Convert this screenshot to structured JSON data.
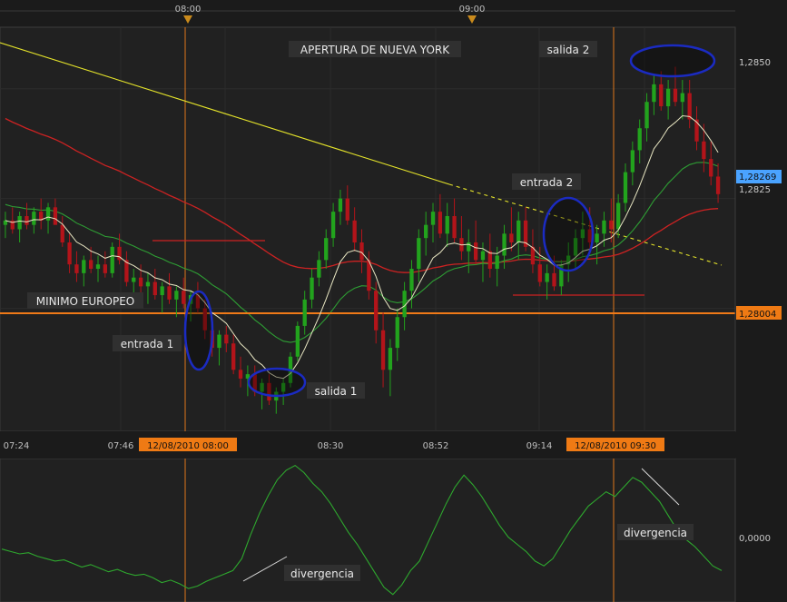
{
  "colors": {
    "background": "#1b1b1b",
    "plot_bg": "#212121",
    "grid": "#2c2c2c",
    "up": "#22a31d",
    "down": "#b3141a",
    "ema_fast": "#e8e6c2",
    "ema_mid": "#2e9e34",
    "ema_slow": "#cc2222",
    "trendline": "#e4e32a",
    "support": "#f07a18",
    "oscillator": "#2ea82e",
    "highlight_ellipse": "#1b2bc2",
    "price_tag_blue": "#4aa3ff",
    "price_tag_orange": "#ef7a14"
  },
  "top_time_markers": [
    "08:00",
    "09:00"
  ],
  "time_axis": {
    "ticks": [
      "07:24",
      "07:46",
      "08:30",
      "08:52",
      "09:14"
    ],
    "highlight_labels": [
      "12/08/2010 08:00",
      "12/08/2010 09:30"
    ]
  },
  "price_axis": {
    "ticks": [
      "1,2850",
      "1,2825"
    ],
    "current_price": "1,28269",
    "support_price": "1,28004"
  },
  "oscillator_axis": {
    "zero_label": "0,0000"
  },
  "annotations": {
    "session_open": "APERTURA DE NUEVA YORK",
    "european_low": "MINIMO EUROPEO",
    "entry1": "entrada 1",
    "exit1": "salida 1",
    "entry2": "entrada 2",
    "exit2": "salida 2",
    "divergence1": "divergencia",
    "divergence2": "divergencia"
  },
  "chart_data": {
    "type": "candlestick",
    "y_range": [
      1.2772,
      1.2864
    ],
    "oscillator_range": [
      -0.0042,
      0.0072
    ],
    "candles": [
      [
        1.2819,
        1.2822,
        1.2816,
        1.282
      ],
      [
        1.282,
        1.2823,
        1.2817,
        1.2818
      ],
      [
        1.2818,
        1.2822,
        1.2815,
        1.2821
      ],
      [
        1.2821,
        1.2824,
        1.2818,
        1.2819
      ],
      [
        1.2819,
        1.2823,
        1.2817,
        1.2822
      ],
      [
        1.2822,
        1.2825,
        1.2818,
        1.282
      ],
      [
        1.282,
        1.2824,
        1.2817,
        1.2823
      ],
      [
        1.2823,
        1.2825,
        1.2819,
        1.2819
      ],
      [
        1.2819,
        1.2821,
        1.2814,
        1.2815
      ],
      [
        1.2815,
        1.2817,
        1.2808,
        1.281
      ],
      [
        1.281,
        1.2813,
        1.2806,
        1.2808
      ],
      [
        1.2808,
        1.2812,
        1.2805,
        1.2811
      ],
      [
        1.2811,
        1.2814,
        1.2808,
        1.2809
      ],
      [
        1.2809,
        1.2812,
        1.2806,
        1.281
      ],
      [
        1.281,
        1.2813,
        1.2807,
        1.2808
      ],
      [
        1.2808,
        1.2815,
        1.2807,
        1.2814
      ],
      [
        1.2814,
        1.2817,
        1.281,
        1.2811
      ],
      [
        1.2811,
        1.2813,
        1.2805,
        1.2806
      ],
      [
        1.2806,
        1.2809,
        1.2802,
        1.2807
      ],
      [
        1.2807,
        1.281,
        1.2803,
        1.2805
      ],
      [
        1.2805,
        1.2808,
        1.2801,
        1.2806
      ],
      [
        1.2806,
        1.2809,
        1.2802,
        1.2803
      ],
      [
        1.2803,
        1.2806,
        1.2799,
        1.2805
      ],
      [
        1.2805,
        1.2808,
        1.2801,
        1.2802
      ],
      [
        1.2802,
        1.2805,
        1.2798,
        1.2804
      ],
      [
        1.2804,
        1.2807,
        1.28,
        1.2801
      ],
      [
        1.2801,
        1.2804,
        1.2797,
        1.2803
      ],
      [
        1.2803,
        1.2806,
        1.2799,
        1.28
      ],
      [
        1.28,
        1.2802,
        1.2793,
        1.2795
      ],
      [
        1.2795,
        1.2798,
        1.2789,
        1.2791
      ],
      [
        1.2791,
        1.2795,
        1.2787,
        1.2794
      ],
      [
        1.2794,
        1.2796,
        1.279,
        1.2792
      ],
      [
        1.2792,
        1.2794,
        1.2785,
        1.2786
      ],
      [
        1.2786,
        1.2789,
        1.2782,
        1.2784
      ],
      [
        1.2784,
        1.2787,
        1.278,
        1.2785
      ],
      [
        1.2785,
        1.2787,
        1.278,
        1.2781
      ],
      [
        1.2781,
        1.2784,
        1.2777,
        1.2783
      ],
      [
        1.2783,
        1.2785,
        1.2778,
        1.2779
      ],
      [
        1.2779,
        1.2782,
        1.2776,
        1.2781
      ],
      [
        1.2781,
        1.2784,
        1.2778,
        1.2783
      ],
      [
        1.2783,
        1.279,
        1.2782,
        1.2789
      ],
      [
        1.2789,
        1.2797,
        1.2788,
        1.2796
      ],
      [
        1.2796,
        1.2804,
        1.2794,
        1.2802
      ],
      [
        1.2802,
        1.2809,
        1.28,
        1.2807
      ],
      [
        1.2807,
        1.2813,
        1.2805,
        1.2811
      ],
      [
        1.2811,
        1.2818,
        1.2809,
        1.2816
      ],
      [
        1.2816,
        1.2824,
        1.2814,
        1.2822
      ],
      [
        1.2822,
        1.2827,
        1.2819,
        1.2825
      ],
      [
        1.2825,
        1.2828,
        1.2819,
        1.282
      ],
      [
        1.282,
        1.2823,
        1.2813,
        1.2815
      ],
      [
        1.2815,
        1.2818,
        1.2808,
        1.2811
      ],
      [
        1.2811,
        1.2813,
        1.2802,
        1.2804
      ],
      [
        1.2804,
        1.2806,
        1.2792,
        1.2795
      ],
      [
        1.2795,
        1.2799,
        1.2782,
        1.2786
      ],
      [
        1.2786,
        1.2793,
        1.278,
        1.2791
      ],
      [
        1.2791,
        1.28,
        1.2788,
        1.2798
      ],
      [
        1.2798,
        1.2806,
        1.2795,
        1.2804
      ],
      [
        1.2804,
        1.2811,
        1.28,
        1.2809
      ],
      [
        1.2809,
        1.2818,
        1.2806,
        1.2816
      ],
      [
        1.2816,
        1.2822,
        1.2812,
        1.2819
      ],
      [
        1.2819,
        1.2824,
        1.2815,
        1.2822
      ],
      [
        1.2822,
        1.2826,
        1.2816,
        1.2817
      ],
      [
        1.2817,
        1.2824,
        1.2814,
        1.2821
      ],
      [
        1.2821,
        1.2825,
        1.2815,
        1.2816
      ],
      [
        1.2816,
        1.2821,
        1.2811,
        1.2813
      ],
      [
        1.2813,
        1.2818,
        1.2808,
        1.2815
      ],
      [
        1.2815,
        1.282,
        1.281,
        1.2811
      ],
      [
        1.2811,
        1.2815,
        1.2806,
        1.2813
      ],
      [
        1.2813,
        1.2817,
        1.2807,
        1.2809
      ],
      [
        1.2809,
        1.2814,
        1.2805,
        1.2812
      ],
      [
        1.2812,
        1.2819,
        1.2809,
        1.2817
      ],
      [
        1.2817,
        1.2823,
        1.2813,
        1.2815
      ],
      [
        1.2815,
        1.2822,
        1.2811,
        1.282
      ],
      [
        1.282,
        1.2823,
        1.2813,
        1.2814
      ],
      [
        1.2814,
        1.2818,
        1.2808,
        1.281
      ],
      [
        1.281,
        1.2814,
        1.2805,
        1.2806
      ],
      [
        1.2806,
        1.281,
        1.2802,
        1.2808
      ],
      [
        1.2808,
        1.2812,
        1.2804,
        1.2805
      ],
      [
        1.2805,
        1.2811,
        1.2803,
        1.281
      ],
      [
        1.281,
        1.2815,
        1.2806,
        1.2812
      ],
      [
        1.2812,
        1.2818,
        1.2809,
        1.2816
      ],
      [
        1.2816,
        1.2822,
        1.2812,
        1.2818
      ],
      [
        1.2818,
        1.2823,
        1.2813,
        1.2815
      ],
      [
        1.2815,
        1.2819,
        1.281,
        1.2817
      ],
      [
        1.2817,
        1.2822,
        1.2814,
        1.282
      ],
      [
        1.282,
        1.2825,
        1.2815,
        1.2818
      ],
      [
        1.2818,
        1.2826,
        1.2816,
        1.2824
      ],
      [
        1.2824,
        1.2833,
        1.2822,
        1.2831
      ],
      [
        1.2831,
        1.2838,
        1.2828,
        1.2836
      ],
      [
        1.2836,
        1.2843,
        1.2833,
        1.2841
      ],
      [
        1.2841,
        1.2849,
        1.2838,
        1.2847
      ],
      [
        1.2847,
        1.2853,
        1.2844,
        1.2851
      ],
      [
        1.2851,
        1.2854,
        1.2845,
        1.2846
      ],
      [
        1.2846,
        1.2852,
        1.2843,
        1.285
      ],
      [
        1.285,
        1.2855,
        1.2846,
        1.2847
      ],
      [
        1.2847,
        1.2852,
        1.2843,
        1.2849
      ],
      [
        1.2849,
        1.2852,
        1.2841,
        1.2843
      ],
      [
        1.2843,
        1.2846,
        1.2836,
        1.2838
      ],
      [
        1.2838,
        1.2842,
        1.2831,
        1.2834
      ],
      [
        1.2834,
        1.2838,
        1.2828,
        1.283
      ],
      [
        1.283,
        1.2833,
        1.2824,
        1.2826
      ]
    ],
    "oscillator": [
      0.0,
      -0.0002,
      -0.0004,
      -0.0003,
      -0.0006,
      -0.0008,
      -0.001,
      -0.0009,
      -0.0012,
      -0.0015,
      -0.0013,
      -0.0016,
      -0.0019,
      -0.0017,
      -0.002,
      -0.0022,
      -0.0021,
      -0.0024,
      -0.0028,
      -0.0026,
      -0.0029,
      -0.0033,
      -0.0031,
      -0.0027,
      -0.0024,
      -0.0021,
      -0.0018,
      -0.0008,
      0.0012,
      0.003,
      0.0045,
      0.0058,
      0.0066,
      0.007,
      0.0064,
      0.0055,
      0.0048,
      0.0038,
      0.0026,
      0.0014,
      0.0004,
      -0.0008,
      -0.002,
      -0.0032,
      -0.0038,
      -0.003,
      -0.0018,
      -0.001,
      0.0006,
      0.0022,
      0.0038,
      0.0052,
      0.0062,
      0.0054,
      0.0044,
      0.0032,
      0.002,
      0.001,
      0.0004,
      -0.0002,
      -0.001,
      -0.0014,
      -0.0008,
      0.0004,
      0.0016,
      0.0026,
      0.0036,
      0.0042,
      0.0048,
      0.0044,
      0.0052,
      0.006,
      0.0056,
      0.0048,
      0.004,
      0.0028,
      0.0016,
      0.0008,
      0.0002,
      -0.0006,
      -0.0014,
      -0.0018
    ]
  }
}
